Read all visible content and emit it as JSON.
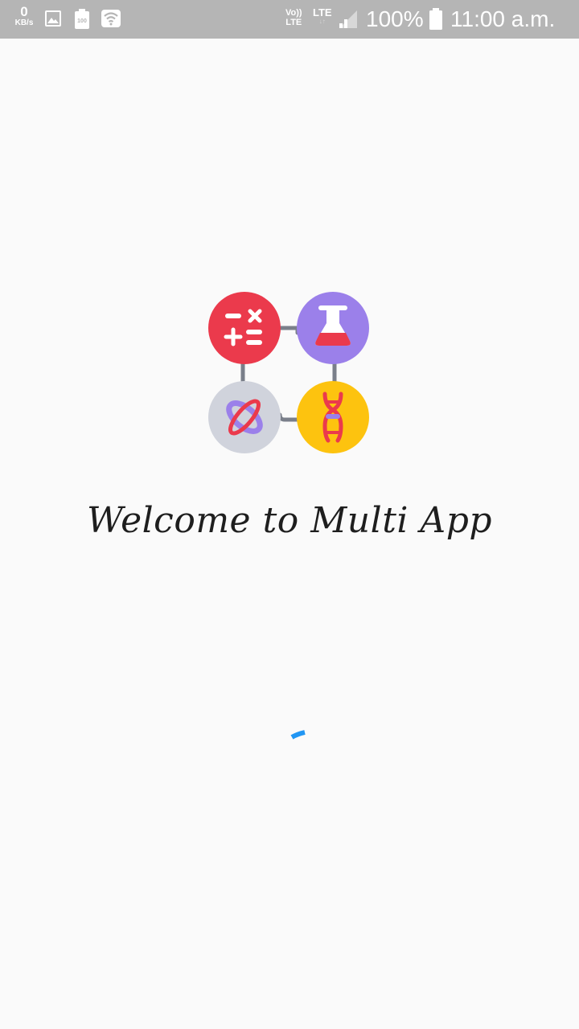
{
  "status_bar": {
    "speed_value": "0",
    "speed_unit": "KB/s",
    "volte_top": "Vo))",
    "volte_bottom": "LTE",
    "network": "LTE",
    "battery_percent": "100%",
    "time": "11:00 a.m.",
    "background": "#b5b5b5",
    "icons": [
      "image-icon",
      "battery-saver-icon",
      "wifi-icon",
      "signal-icon",
      "battery-icon"
    ]
  },
  "splash": {
    "welcome_text": "Welcome to Multi App",
    "logo_icons": [
      "calculator-icon",
      "flask-icon",
      "atom-icon",
      "dna-icon"
    ],
    "colors": {
      "calculator": "#eb3a4c",
      "flask": "#9b80ea",
      "atom": "#d0d3dc",
      "dna": "#fdc30f",
      "connector": "#7a7f8a",
      "spinner": "#2196f3"
    }
  }
}
